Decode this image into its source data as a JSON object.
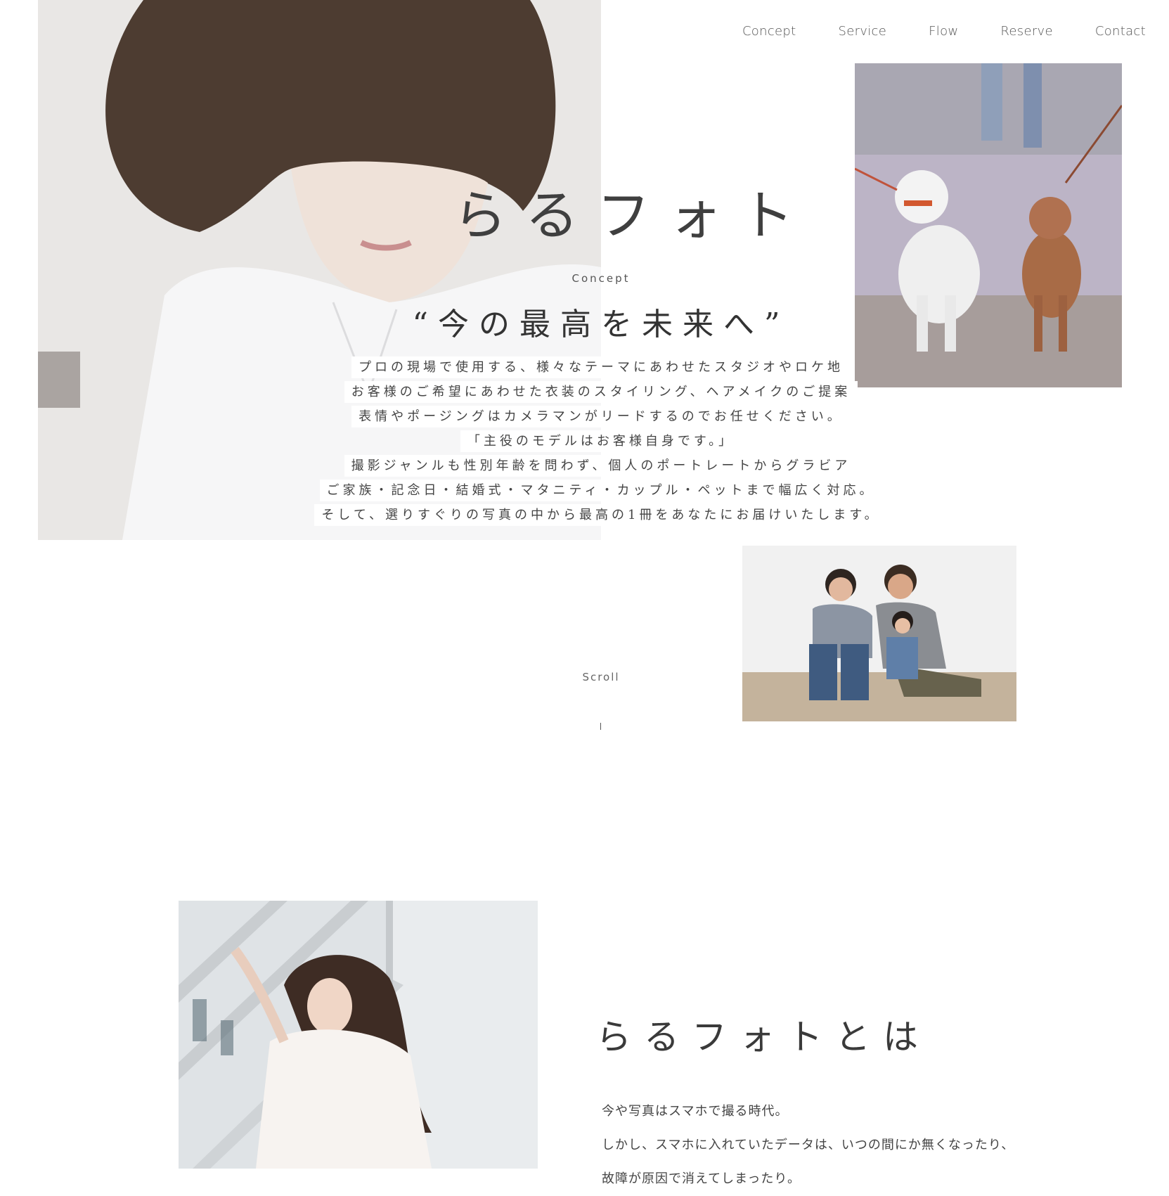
{
  "nav": {
    "items": [
      "Concept",
      "Service",
      "Flow",
      "Reserve",
      "Contact"
    ]
  },
  "hero": {
    "brand": "らるフォト",
    "concept_label": "Concept",
    "tagline": "“今の最高を未来へ”",
    "lines": [
      "プロの現場で使用する、様々なテーマにあわせたスタジオやロケ地",
      "お客様のご希望にあわせた衣装のスタイリング、ヘアメイクのご提案",
      "表情やポージングはカメラマンがリードするのでお任せください。",
      "「主役のモデルはお客様自身です。」",
      "撮影ジャンルも性別年齢を問わず、個人のポートレートからグラビア",
      "ご家族・記念日・結婚式・マタニティ・カップル・ペットまで幅広く対応。",
      "そして、選りすぐりの写真の中から最高の1冊をあなたにお届けいたします。"
    ],
    "scroll": "Scroll"
  },
  "about": {
    "title": "らるフォトとは",
    "paragraphs": [
      "今や写真はスマホで撮る時代。",
      "しかし、スマホに入れていたデータは、いつの間にか無くなったり、",
      "故障が原因で消えてしまったり。"
    ]
  }
}
